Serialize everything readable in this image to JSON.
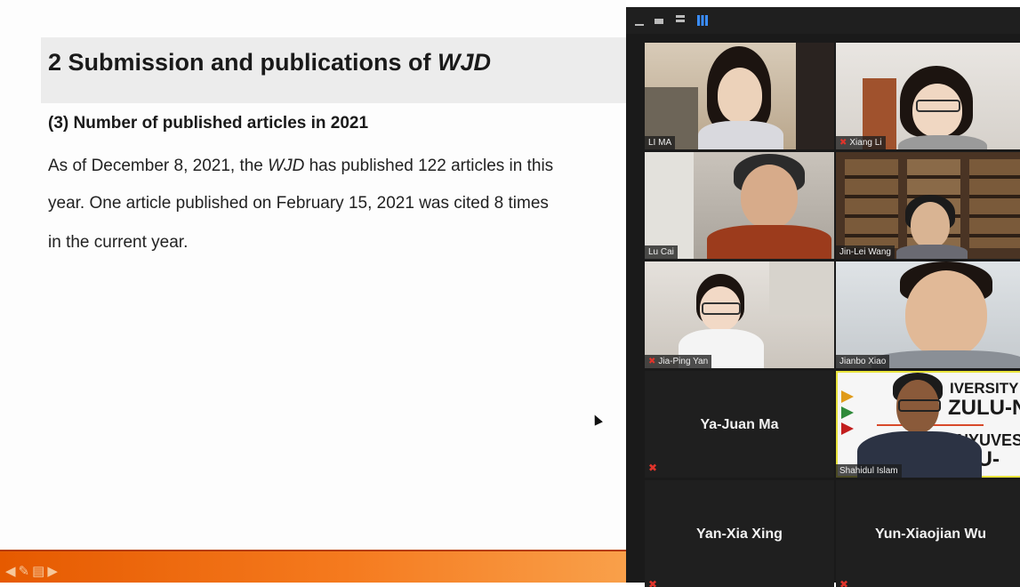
{
  "slide": {
    "title_prefix": "2 Submission and publications of ",
    "title_italic": "WJD",
    "subheading": "(3) Number of published articles in 2021",
    "line1_before": "As of December 8, 2021, the ",
    "line1_italic": "WJD",
    "line1_after": " has published 122 articles in this",
    "line2": "year. One article published on February 15, 2021 was cited 8 times",
    "line3": "in the current year.",
    "nav_icons": [
      "◀",
      "✎",
      "▤",
      "▶"
    ]
  },
  "zoom": {
    "participants": [
      {
        "name": "LI MA",
        "muted": false
      },
      {
        "name": "Xiang Li",
        "muted": true
      },
      {
        "name": "Lu Cai",
        "muted": false
      },
      {
        "name": "Jin-Lei Wang",
        "muted": false
      },
      {
        "name": "Jia-Ping Yan",
        "muted": true
      },
      {
        "name": "Jianbo Xiao",
        "muted": false
      },
      {
        "name": "Ya-Juan Ma",
        "muted": true
      },
      {
        "name": "Shahidul Islam",
        "muted": false
      },
      {
        "name": "Yan-Xia Xing",
        "muted": true
      },
      {
        "name": "Yun-Xiaojian Wu",
        "muted": true
      }
    ],
    "banner_line1": "IVERSITY",
    "banner_line2": "ZULU-N",
    "banner_line3": "NYUVESI",
    "banner_line4": "LU-",
    "colors": {
      "mute_red": "#e0342b",
      "active_speaker": "#e8e33a",
      "view_accent": "#3a8dff"
    }
  }
}
